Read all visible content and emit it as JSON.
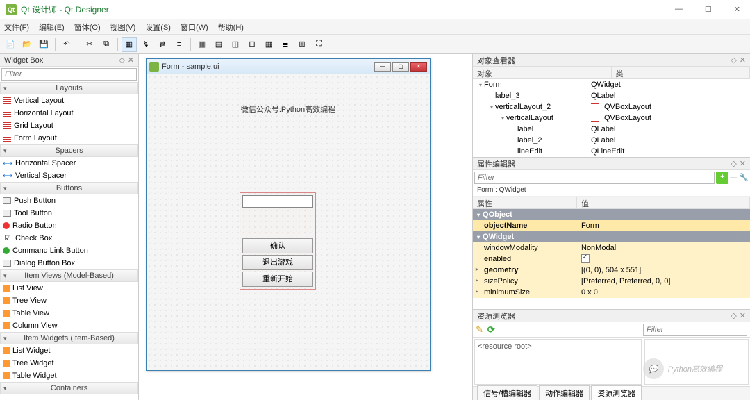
{
  "titlebar": {
    "title": "Qt 设计师 - Qt Designer"
  },
  "menu": [
    "文件(F)",
    "编辑(E)",
    "窗体(O)",
    "视图(V)",
    "设置(S)",
    "窗口(W)",
    "帮助(H)"
  ],
  "widget_box": {
    "title": "Widget Box",
    "filter_placeholder": "Filter",
    "categories": [
      {
        "name": "Layouts",
        "items": [
          "Vertical Layout",
          "Horizontal Layout",
          "Grid Layout",
          "Form Layout"
        ]
      },
      {
        "name": "Spacers",
        "items": [
          "Horizontal Spacer",
          "Vertical Spacer"
        ]
      },
      {
        "name": "Buttons",
        "items": [
          "Push Button",
          "Tool Button",
          "Radio Button",
          "Check Box",
          "Command Link Button",
          "Dialog Button Box"
        ]
      },
      {
        "name": "Item Views (Model-Based)",
        "items": [
          "List View",
          "Tree View",
          "Table View",
          "Column View"
        ]
      },
      {
        "name": "Item Widgets (Item-Based)",
        "items": [
          "List Widget",
          "Tree Widget",
          "Table Widget"
        ]
      },
      {
        "name": "Containers",
        "items": []
      }
    ]
  },
  "form": {
    "window_title": "Form - sample.ui",
    "top_label": "微信公众号:Python高效编程",
    "buttons": [
      "确认",
      "退出游戏",
      "重新开始"
    ]
  },
  "object_inspector": {
    "title": "对象查看器",
    "columns": [
      "对象",
      "类"
    ],
    "rows": [
      {
        "indent": 0,
        "disclosure": "▾",
        "name": "Form",
        "class": "QWidget",
        "icon": "widget"
      },
      {
        "indent": 1,
        "disclosure": "",
        "name": "label_3",
        "class": "QLabel",
        "icon": "label"
      },
      {
        "indent": 1,
        "disclosure": "▾",
        "name": "verticalLayout_2",
        "class": "QVBoxLayout",
        "icon": "vlayout",
        "sel": false
      },
      {
        "indent": 2,
        "disclosure": "▾",
        "name": "verticalLayout",
        "class": "QVBoxLayout",
        "icon": "vlayout"
      },
      {
        "indent": 3,
        "disclosure": "",
        "name": "label",
        "class": "QLabel",
        "icon": "label"
      },
      {
        "indent": 3,
        "disclosure": "",
        "name": "label_2",
        "class": "QLabel",
        "icon": "label"
      },
      {
        "indent": 3,
        "disclosure": "",
        "name": "lineEdit",
        "class": "QLineEdit",
        "icon": "lineedit"
      }
    ]
  },
  "property_editor": {
    "title": "属性编辑器",
    "filter_placeholder": "Filter",
    "context": "Form : QWidget",
    "columns": [
      "属性",
      "值"
    ],
    "groups": [
      {
        "name": "QObject",
        "rows": [
          {
            "name": "objectName",
            "value": "Form",
            "bold": true
          }
        ]
      },
      {
        "name": "QWidget",
        "rows": [
          {
            "name": "windowModality",
            "value": "NonModal"
          },
          {
            "name": "enabled",
            "value": "checkbox:true"
          },
          {
            "name": "geometry",
            "value": "[(0, 0), 504 x 551]",
            "bold": true,
            "expand": true
          },
          {
            "name": "sizePolicy",
            "value": "[Preferred, Preferred, 0, 0]",
            "expand": true
          },
          {
            "name": "minimumSize",
            "value": "0 x 0",
            "expand": true
          }
        ]
      }
    ]
  },
  "resource_browser": {
    "title": "资源浏览器",
    "filter_placeholder": "Filter",
    "root_label": "<resource root>"
  },
  "bottom_tabs": [
    "信号/槽编辑器",
    "动作编辑器",
    "资源浏览器"
  ],
  "watermark": "Python高效编程"
}
